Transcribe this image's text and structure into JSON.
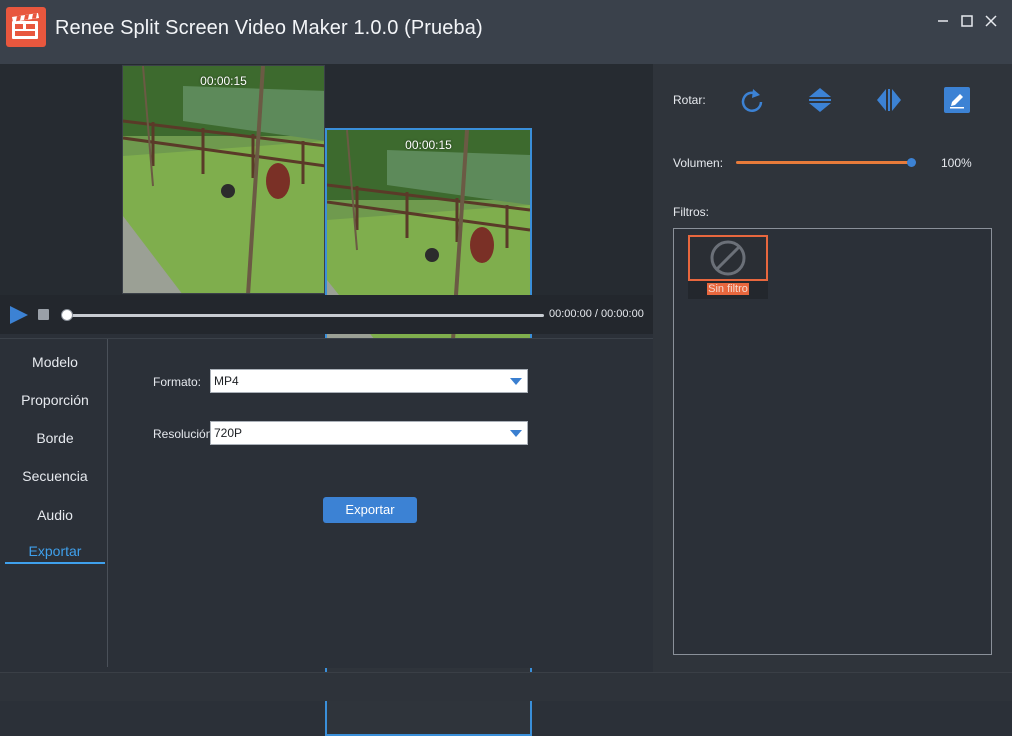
{
  "window": {
    "title": "Renee Split Screen Video Maker 1.0.0 (Prueba)",
    "logo_icon": "film-clapper-logo-icon",
    "controls": {
      "minimize": "—",
      "maximize": "☐",
      "close": "✕"
    }
  },
  "preview": {
    "left_clip_time": "00:00:15",
    "right_clip_time": "00:00:15",
    "selected_clip": "right"
  },
  "player": {
    "time": "00:00:00 / 00:00:00",
    "progress": 0
  },
  "tabs": [
    {
      "label": "Modelo"
    },
    {
      "label": "Proporción"
    },
    {
      "label": "Borde"
    },
    {
      "label": "Secuencia"
    },
    {
      "label": "Audio"
    },
    {
      "label": "Exportar"
    }
  ],
  "active_tab": "Exportar",
  "export_form": {
    "format_label": "Formato:",
    "format_value": "MP4",
    "resolution_label": "Resolución",
    "resolution_value": "720P",
    "export_button": "Exportar"
  },
  "side": {
    "rotate_label": "Rotar:",
    "volume_label": "Volumen:",
    "volume_value": "100%",
    "volume_level": 1.0,
    "filters_label": "Filtros:",
    "filters": [
      {
        "name": "Sin filtro",
        "selected": true
      }
    ]
  },
  "colors": {
    "accent_blue": "#3c82d4",
    "accent_orange": "#e8673e",
    "title_bar": "#3a414b",
    "background": "#2b3038"
  }
}
